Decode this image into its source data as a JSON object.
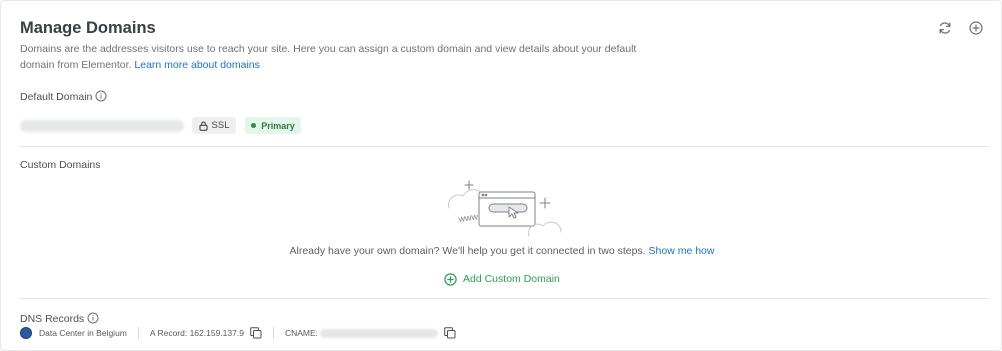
{
  "header": {
    "title": "Manage Domains",
    "description": "Domains are the addresses visitors use to reach your site. Here you can assign a custom domain and view details about your default domain from Elementor.",
    "learn_more": "Learn more about domains",
    "refresh_icon": "refresh-icon",
    "add_icon": "add-circle-icon"
  },
  "default_domain": {
    "label": "Default Domain",
    "ssl_label": "SSL",
    "primary_label": "Primary"
  },
  "custom_domains": {
    "label": "Custom Domains",
    "empty_text": "Already have your own domain? We'll help you get it connected in two steps.",
    "show_me_how": "Show me how",
    "add_label": "Add Custom Domain"
  },
  "dns_records": {
    "label": "DNS Records",
    "data_center": "Data Center in Belgium",
    "a_record": "A Record: 162.159.137.9",
    "cname_label": "CNAME:"
  },
  "colors": {
    "accent_link": "#1a73c9",
    "success_green": "#2e9e56",
    "primary_badge_bg": "#e4f5e9"
  }
}
